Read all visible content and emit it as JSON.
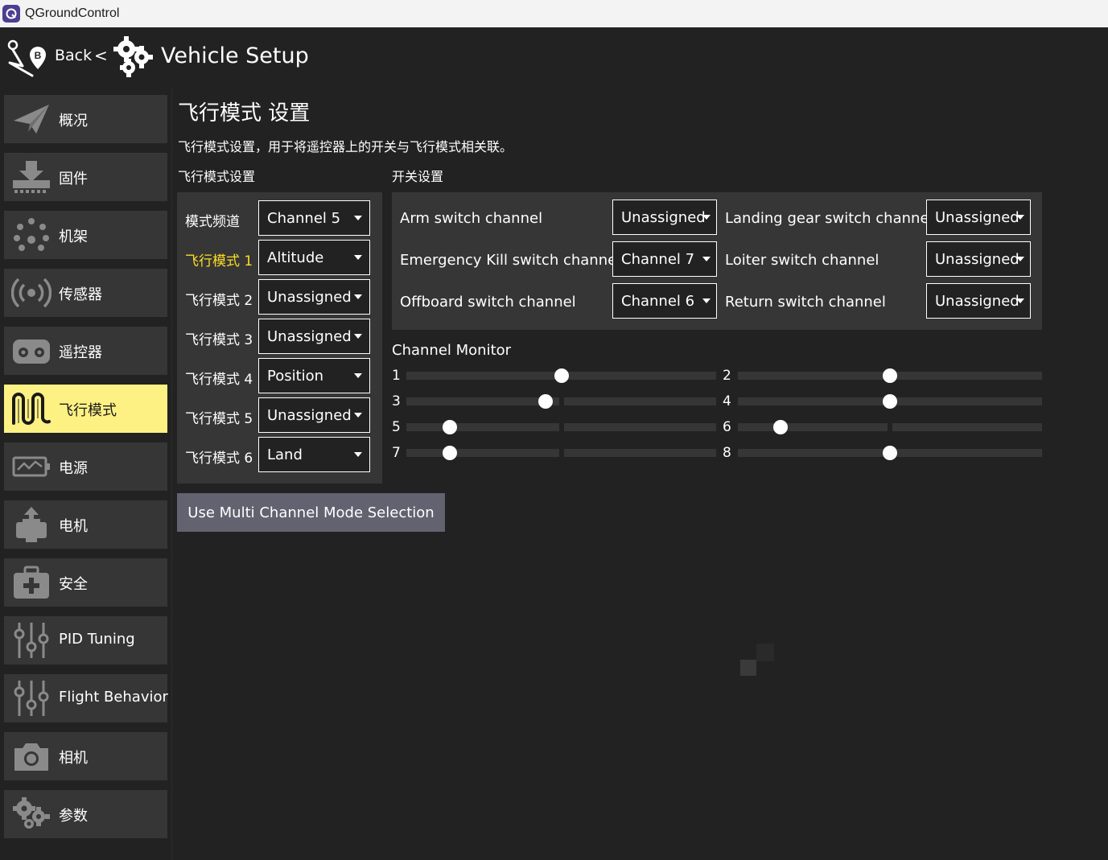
{
  "window": {
    "title": "QGroundControl"
  },
  "header": {
    "back_label": "Back",
    "separator": "<",
    "title": "Vehicle Setup"
  },
  "sidebar": {
    "items": [
      {
        "label": "概况",
        "icon": "paper-plane-icon",
        "active": false
      },
      {
        "label": "固件",
        "icon": "download-firmware-icon",
        "active": false
      },
      {
        "label": "机架",
        "icon": "airframe-dots-icon",
        "active": false
      },
      {
        "label": "传感器",
        "icon": "sensor-waves-icon",
        "active": false
      },
      {
        "label": "遥控器",
        "icon": "remote-controller-icon",
        "active": false
      },
      {
        "label": "飞行模式",
        "icon": "flight-modes-wave-icon",
        "active": true
      },
      {
        "label": "电源",
        "icon": "battery-power-icon",
        "active": false
      },
      {
        "label": "电机",
        "icon": "motor-icon",
        "active": false
      },
      {
        "label": "安全",
        "icon": "safety-medkit-icon",
        "active": false
      },
      {
        "label": "PID Tuning",
        "icon": "tuning-sliders-icon",
        "active": false
      },
      {
        "label": "Flight Behavior",
        "icon": "tuning-sliders-icon",
        "active": false
      },
      {
        "label": "相机",
        "icon": "camera-icon",
        "active": false
      },
      {
        "label": "参数",
        "icon": "gears-icon",
        "active": false
      }
    ]
  },
  "page": {
    "title": "飞行模式 设置",
    "description": "飞行模式设置，用于将遥控器上的开关与飞行模式相关联。",
    "left_section_title": "飞行模式设置",
    "right_section_title": "开关设置"
  },
  "modes": [
    {
      "label": "模式频道",
      "value": "Channel 5",
      "highlight": false
    },
    {
      "label": "飞行模式 1",
      "value": "Altitude",
      "highlight": true
    },
    {
      "label": "飞行模式 2",
      "value": "Unassigned",
      "highlight": false
    },
    {
      "label": "飞行模式 3",
      "value": "Unassigned",
      "highlight": false
    },
    {
      "label": "飞行模式 4",
      "value": "Position",
      "highlight": false
    },
    {
      "label": "飞行模式 5",
      "value": "Unassigned",
      "highlight": false
    },
    {
      "label": "飞行模式 6",
      "value": "Land",
      "highlight": false
    }
  ],
  "switches": {
    "arm_label": "Arm switch channel",
    "arm_value": "Unassigned",
    "kill_label": "Emergency Kill switch channel",
    "kill_value": "Channel 7",
    "offboard_label": "Offboard switch channel",
    "offboard_value": "Channel 6",
    "gear_label": "Landing gear switch channel",
    "gear_value": "Unassigned",
    "loiter_label": "Loiter switch channel",
    "loiter_value": "Unassigned",
    "return_label": "Return switch channel",
    "return_value": "Unassigned"
  },
  "channel_monitor": {
    "title": "Channel Monitor",
    "channels": [
      {
        "label": "1",
        "level": 0.5
      },
      {
        "label": "2",
        "level": 0.5
      },
      {
        "label": "3",
        "level": 0.45
      },
      {
        "label": "4",
        "level": 0.5
      },
      {
        "label": "5",
        "level": 0.14
      },
      {
        "label": "6",
        "level": 0.14
      },
      {
        "label": "7",
        "level": 0.14
      },
      {
        "label": "8",
        "level": 0.5
      }
    ]
  },
  "multi_channel_button": "Use Multi Channel Mode Selection",
  "colors": {
    "background": "#222222",
    "panel": "#363636",
    "active_nav": "#fdf184",
    "mode_highlight": "#ffdd23",
    "button": "#626270"
  }
}
